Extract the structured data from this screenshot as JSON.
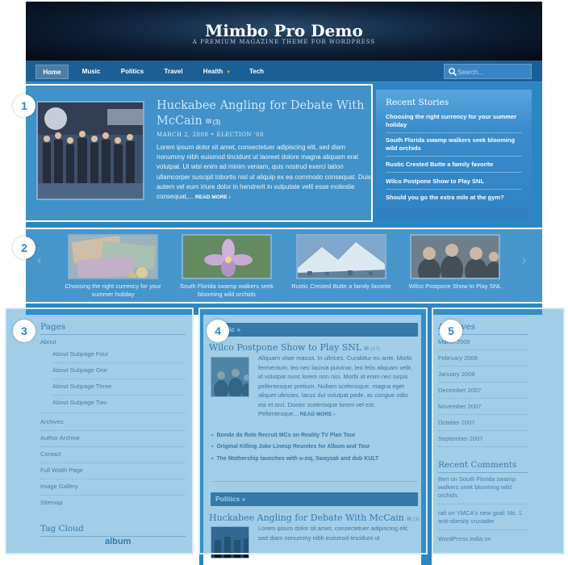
{
  "header": {
    "title": "Mimbo Pro Demo",
    "tagline": "A PREMIUM MAGAZINE THEME FOR WORDPRESS"
  },
  "nav": {
    "items": [
      "Home",
      "Music",
      "Politics",
      "Travel",
      "Health",
      "Tech"
    ],
    "active": "Home",
    "search_placeholder": "Search..."
  },
  "featured": {
    "title": "Huckabee Angling for Debate With McCain",
    "comments": "(3)",
    "meta": "MARCH 2, 2008 • ELECTION '08",
    "excerpt": "Lorem ipsum dolor sit amet, consectetuer adipiscing elit, sed diam nonummy nibh euismod tincidunt ut laoreet dolore magna aliquam erat volutpat. Ut wisi enim ad minim veniam, quis nostrud exerci tation ullamcorper suscipit lobortis nisl ut aliquip ex ea commodo consequat. Duis autem vel eum iriure dolor in hendrerit in vulputate velit esse molestie consequat,...",
    "more": "READ MORE ›"
  },
  "recent_stories": {
    "title": "Recent Stories",
    "items": [
      "Choosing the right currency for your summer holiday",
      "South Florida swamp walkers seek blooming wild orchids",
      "Rustic Crested Butte a family favorite",
      "Wilco Postpone Show to Play SNL",
      "Should you go the extra mile at the gym?"
    ]
  },
  "carousel": {
    "prev": "‹",
    "next": "›",
    "items": [
      {
        "caption": "Choosing the right currency for your summer holiday",
        "image": "currency-notes"
      },
      {
        "caption": "South Florida swamp walkers seek blooming wild orchids",
        "image": "orchid-flower"
      },
      {
        "caption": "Rustic Crested Butte a family favorite",
        "image": "mountain-village"
      },
      {
        "caption": "Wilco Postpone Show to Play SNL",
        "image": "band-photo"
      }
    ]
  },
  "pages": {
    "title": "Pages",
    "about": "About",
    "subpages": [
      "About Subpage Four",
      "About Subpage One",
      "About Subpage Three",
      "About Subpage Two"
    ],
    "links": [
      "Archives",
      "Author Archive",
      "Contact",
      "Full Width Page",
      "Image Gallery",
      "Sitemap"
    ],
    "tag_cloud_title": "Tag Cloud",
    "tag_word": "album"
  },
  "middle": {
    "cat1": "Music »",
    "post1": {
      "title": "Wilco Postpone Show to Play SNL",
      "comments": "(17)",
      "excerpt": "Aliquam vitae massa. In ultrices. Curabitur eu ante. Morbi fermentum, leo nec lacinia pulvinar, leo felis aliquam velit, id volutpat nunc lorem non nisi. Morbi at enim nec turpis pellentesque pretium. Nullam scelerisque, magna eget aliquet ultricies, lacus dui volutpat pede, ac congue odio est et orci. Donec scelerisque lorem vel est. Pellentesque...",
      "more": "READ MORE ›"
    },
    "related": [
      "Bonde do Role Recruit MCs on Reality TV Plan Tour",
      "Original Killing Joke Lineup Reunites for Album and Tour",
      "The Mothership launches with u-ziq, Swayzak and dub KULT"
    ],
    "cat2": "Politics »",
    "post2": {
      "title": "Huckabee Angling for Debate With McCain",
      "comments": "(3)",
      "excerpt": "Lorem ipsum dolor sit amet, consectetuer adipiscing elit, sed diam nonummy nibh euismod tincidunt ut"
    }
  },
  "archives": {
    "title": "Archives",
    "months": [
      "March 2008",
      "February 2008",
      "January 2008",
      "December 2007",
      "November 2007",
      "October 2007",
      "September 2007"
    ],
    "comments_title": "Recent Comments",
    "comments": [
      "Ben on South Florida swamp walkers seek blooming wild orchids",
      "rafi on YMCA's new goal: No. 1 anti-obesity crusader",
      "WordPress India on"
    ]
  },
  "annotations": [
    "1",
    "2",
    "3",
    "4",
    "5"
  ],
  "colors": {
    "site_blue": "#2b86c2",
    "nav_blue": "#1b5f94",
    "heading_blue": "#2c5f86",
    "badge_text": "#2f86c4"
  }
}
